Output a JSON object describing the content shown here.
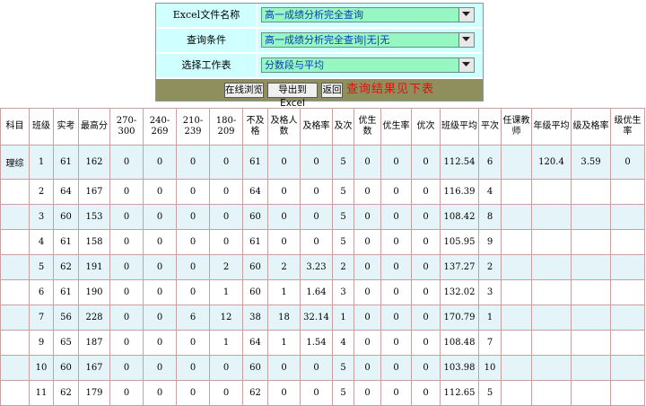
{
  "query": {
    "file_label": "Excel文件名称",
    "file_value": "高一成绩分析完全查询",
    "condition_label": "查询条件",
    "condition_value": "高一成绩分析完全查询|无|无",
    "worksheet_label": "选择工作表",
    "worksheet_value": "分数段与平均",
    "browse_button": "在线浏览",
    "export_button": "导出到Excel",
    "back_button": "返回",
    "result_message": "查询结果见下表"
  },
  "table": {
    "headers": [
      "科目",
      "班级",
      "实考",
      "最高分",
      "270-300",
      "240-269",
      "210-239",
      "180-209",
      "不及格",
      "及格人数",
      "及格率",
      "及次",
      "优生数",
      "优生率",
      "优次",
      "班级平均",
      "平次",
      "任课教师",
      "年级平均",
      "级及格率",
      "级优生率"
    ],
    "rows": [
      [
        "理综",
        "1",
        "61",
        "162",
        "0",
        "0",
        "0",
        "0",
        "61",
        "0",
        "0",
        "5",
        "0",
        "0",
        "0",
        "112.54",
        "6",
        "",
        "120.4",
        "3.59",
        "0"
      ],
      [
        "",
        "2",
        "64",
        "167",
        "0",
        "0",
        "0",
        "0",
        "64",
        "0",
        "0",
        "5",
        "0",
        "0",
        "0",
        "116.39",
        "4",
        "",
        "",
        "",
        ""
      ],
      [
        "",
        "3",
        "60",
        "153",
        "0",
        "0",
        "0",
        "0",
        "60",
        "0",
        "0",
        "5",
        "0",
        "0",
        "0",
        "108.42",
        "8",
        "",
        "",
        "",
        ""
      ],
      [
        "",
        "4",
        "61",
        "158",
        "0",
        "0",
        "0",
        "0",
        "61",
        "0",
        "0",
        "5",
        "0",
        "0",
        "0",
        "105.95",
        "9",
        "",
        "",
        "",
        ""
      ],
      [
        "",
        "5",
        "62",
        "191",
        "0",
        "0",
        "0",
        "2",
        "60",
        "2",
        "3.23",
        "2",
        "0",
        "0",
        "0",
        "137.27",
        "2",
        "",
        "",
        "",
        ""
      ],
      [
        "",
        "6",
        "61",
        "190",
        "0",
        "0",
        "0",
        "1",
        "60",
        "1",
        "1.64",
        "3",
        "0",
        "0",
        "0",
        "132.02",
        "3",
        "",
        "",
        "",
        ""
      ],
      [
        "",
        "7",
        "56",
        "228",
        "0",
        "0",
        "6",
        "12",
        "38",
        "18",
        "32.14",
        "1",
        "0",
        "0",
        "0",
        "170.79",
        "1",
        "",
        "",
        "",
        ""
      ],
      [
        "",
        "9",
        "65",
        "187",
        "0",
        "0",
        "0",
        "1",
        "64",
        "1",
        "1.54",
        "4",
        "0",
        "0",
        "0",
        "108.48",
        "7",
        "",
        "",
        "",
        ""
      ],
      [
        "",
        "10",
        "60",
        "167",
        "0",
        "0",
        "0",
        "0",
        "60",
        "0",
        "0",
        "5",
        "0",
        "0",
        "0",
        "103.98",
        "10",
        "",
        "",
        "",
        ""
      ],
      [
        "",
        "11",
        "62",
        "179",
        "0",
        "0",
        "0",
        "0",
        "62",
        "0",
        "0",
        "5",
        "0",
        "0",
        "0",
        "112.65",
        "5",
        "",
        "",
        "",
        ""
      ]
    ]
  }
}
